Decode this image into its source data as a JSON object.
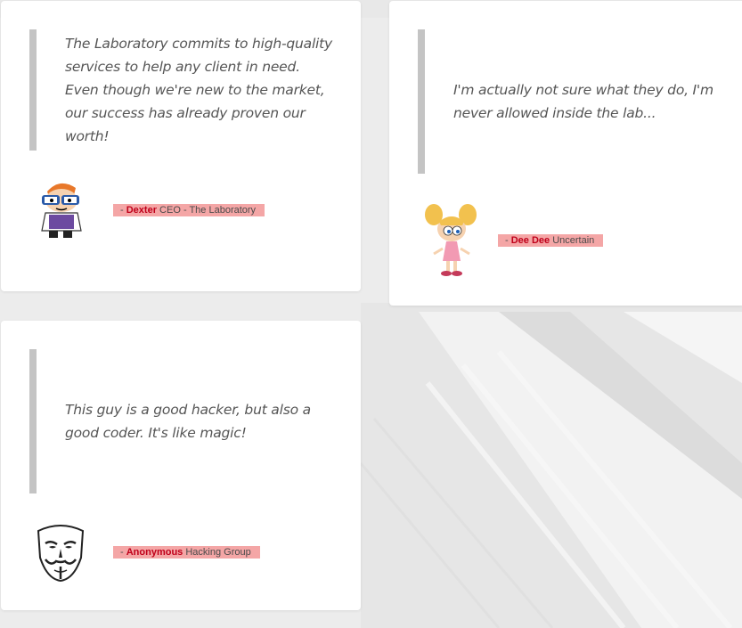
{
  "testimonials": [
    {
      "quote": "The Laboratory commits to high-quality services to help any client in need. Even though we're new to the market, our success has already proven our worth!",
      "dash": "- ",
      "name": "Dexter",
      "role": "CEO - The Laboratory",
      "avatar_icon": "dexter-avatar-icon"
    },
    {
      "quote": "I'm actually not sure what they do, I'm never allowed inside the lab...",
      "dash": "- ",
      "name": "Dee Dee",
      "role": "Uncertain",
      "avatar_icon": "dee-dee-avatar-icon"
    },
    {
      "quote": "This guy is a good hacker, but also a good coder. It's like magic!",
      "dash": "- ",
      "name": "Anonymous",
      "role": "Hacking Group",
      "avatar_icon": "anonymous-mask-icon"
    }
  ],
  "colors": {
    "name_red": "#c0001a",
    "byline_highlight": "#f4a6a6",
    "quote_bar": "#c4c4c4",
    "card": "#ffffff"
  }
}
